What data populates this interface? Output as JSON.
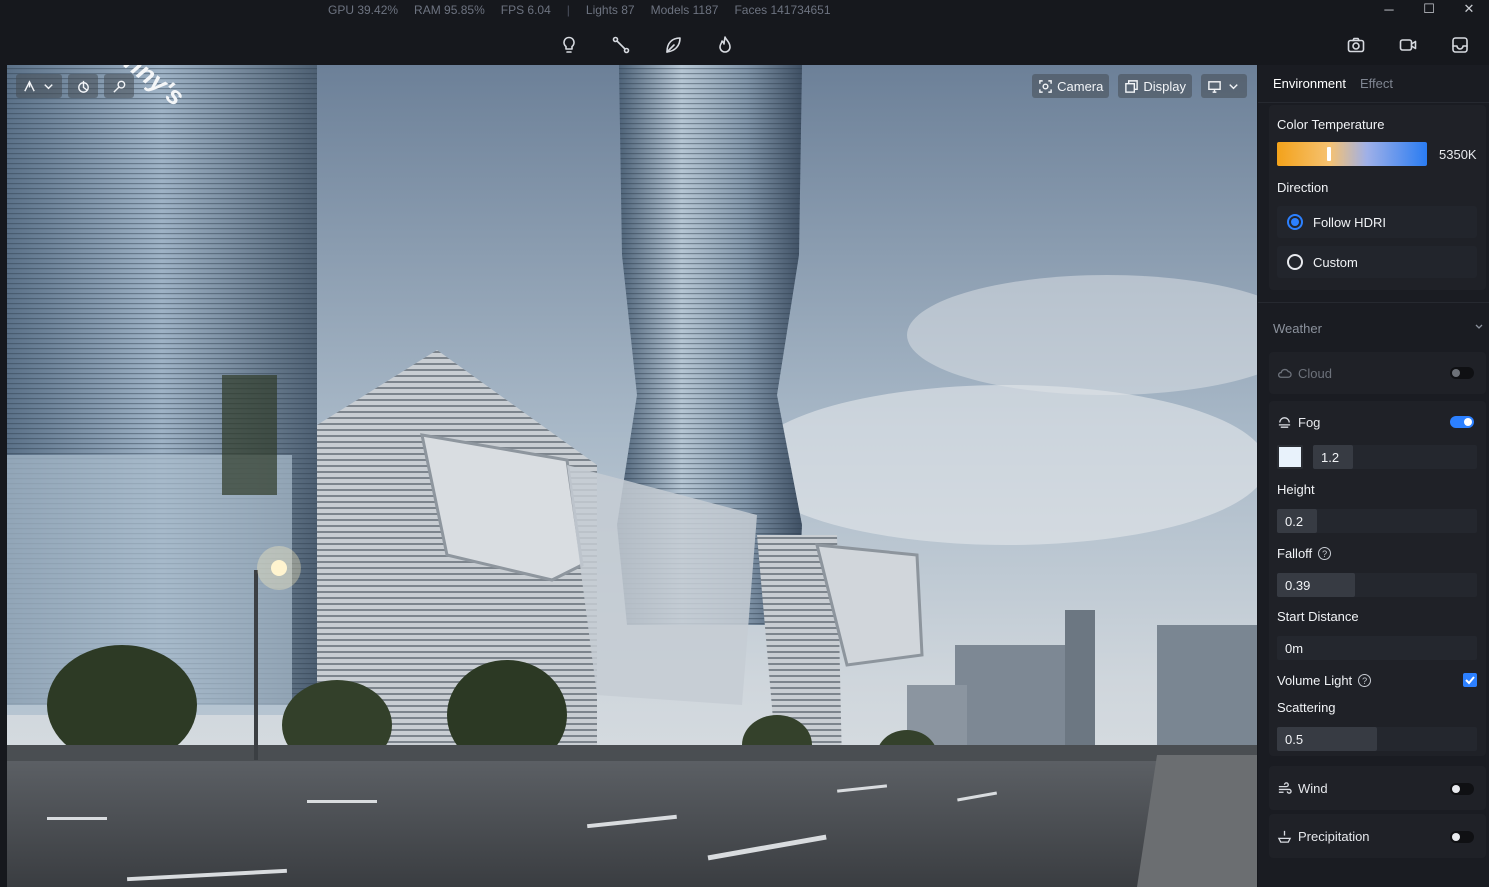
{
  "stats": {
    "gpu": "GPU 39.42%",
    "ram": "RAM 95.85%",
    "fps": "FPS 6.04",
    "separator": "|",
    "lights": "Lights 87",
    "models": "Models 1187",
    "faces": "Faces 141734651"
  },
  "window_controls": {
    "minimize": "─",
    "maximize": "☐",
    "close": "✕"
  },
  "toolbar": {
    "center_icons": [
      "lightbulb-icon",
      "path-tool-icon",
      "leaf-icon",
      "fire-icon"
    ],
    "right_icons": [
      "camera-icon",
      "video-icon",
      "inbox-icon"
    ]
  },
  "viewport": {
    "camera_label": "Camera",
    "display_label": "Display",
    "sign_text": "nny's"
  },
  "panel": {
    "tabs": [
      "Environment",
      "Effect"
    ],
    "active_tab": "Environment",
    "color_temperature": {
      "label": "Color Temperature",
      "value": "5350K",
      "position": 0.34
    },
    "direction": {
      "label": "Direction",
      "options": [
        "Follow HDRI",
        "Custom"
      ],
      "selected": "Follow HDRI"
    },
    "weather": {
      "label": "Weather",
      "cloud": {
        "label": "Cloud",
        "enabled": false
      },
      "fog": {
        "label": "Fog",
        "enabled": true,
        "color": "#e8f2fb",
        "density": "1.2",
        "height_label": "Height",
        "height": "0.2",
        "height_fill": 0.2,
        "falloff_label": "Falloff",
        "falloff": "0.39",
        "falloff_fill": 0.39,
        "start_distance_label": "Start Distance",
        "start_distance": "0m",
        "volume_light_label": "Volume Light",
        "volume_light": true,
        "scattering_label": "Scattering",
        "scattering": "0.5",
        "scattering_fill": 0.5
      },
      "wind": {
        "label": "Wind",
        "enabled": false
      },
      "precipitation": {
        "label": "Precipitation",
        "enabled": false
      }
    }
  },
  "colors": {
    "accent": "#2c80ff",
    "panel_bg": "#1a1c22",
    "app_bg": "#16181d"
  }
}
